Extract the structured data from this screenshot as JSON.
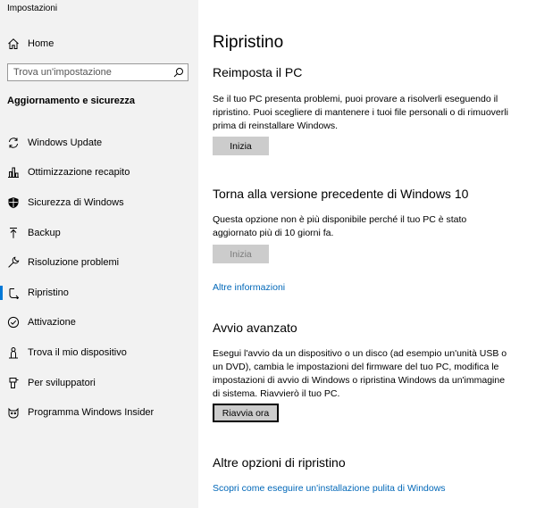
{
  "window": {
    "title": "Impostazioni"
  },
  "sidebar": {
    "home_label": "Home",
    "search_placeholder": "Trova un'impostazione",
    "section_title": "Aggiornamento e sicurezza",
    "items": [
      {
        "label": "Windows Update",
        "icon": "sync-icon"
      },
      {
        "label": "Ottimizzazione recapito",
        "icon": "delivery-optimization-icon"
      },
      {
        "label": "Sicurezza di Windows",
        "icon": "shield-icon"
      },
      {
        "label": "Backup",
        "icon": "backup-arrow-icon"
      },
      {
        "label": "Risoluzione problemi",
        "icon": "wrench-icon"
      },
      {
        "label": "Ripristino",
        "icon": "recovery-icon"
      },
      {
        "label": "Attivazione",
        "icon": "check-circle-icon"
      },
      {
        "label": "Trova il mio dispositivo",
        "icon": "person-pin-icon"
      },
      {
        "label": "Per sviluppatori",
        "icon": "developer-icon"
      },
      {
        "label": "Programma Windows Insider",
        "icon": "insider-cat-icon"
      }
    ],
    "selected_index": 5
  },
  "main": {
    "title": "Ripristino",
    "reset": {
      "heading": "Reimposta il PC",
      "description": "Se il tuo PC presenta problemi, puoi provare a risolverli eseguendo il ripristino. Puoi scegliere di mantenere i tuoi file personali o di rimuoverli prima di reinstallare Windows.",
      "button": "Inizia"
    },
    "rollback": {
      "heading": "Torna alla versione precedente di Windows 10",
      "description": "Questa opzione non è più disponibile perché il tuo PC è stato aggiornato più di 10 giorni fa.",
      "button": "Inizia",
      "link": "Altre informazioni"
    },
    "advanced": {
      "heading": "Avvio avanzato",
      "description": "Esegui l'avvio da un dispositivo o un disco (ad esempio un'unità USB o un DVD), cambia le impostazioni del firmware del tuo PC, modifica le impostazioni di avvio di Windows o ripristina Windows da un'immagine di sistema. Riavvierò il tuo PC.",
      "button": "Riavvia ora"
    },
    "other": {
      "heading": "Altre opzioni di ripristino",
      "link": "Scopri come eseguire un'installazione pulita di Windows"
    }
  },
  "colors": {
    "accent": "#0078d7",
    "link": "#0067b8",
    "sidebar_bg": "#f2f2f2",
    "button_bg": "#cccccc"
  }
}
